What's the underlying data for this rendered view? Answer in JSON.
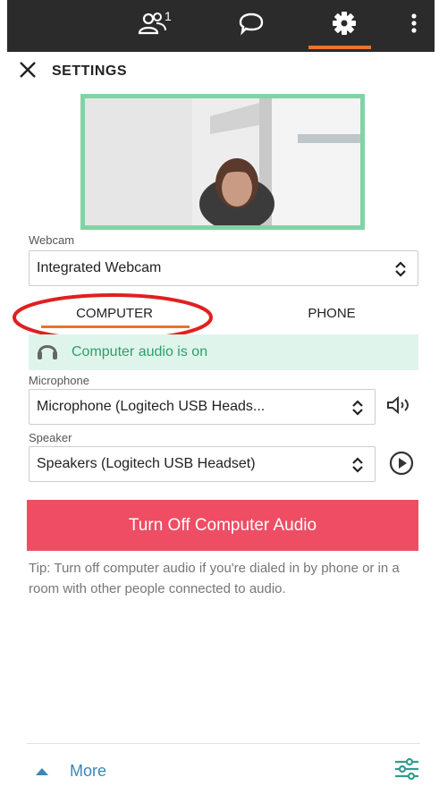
{
  "topbar": {
    "participant_count": "1",
    "icons": [
      "people-icon",
      "chat-icon",
      "gear-icon",
      "more-vertical-icon"
    ],
    "active_tab_color": "#e8742c"
  },
  "header": {
    "title": "SETTINGS"
  },
  "webcam": {
    "label": "Webcam",
    "selected": "Integrated Webcam"
  },
  "audio_tabs": {
    "computer": "COMPUTER",
    "phone": "PHONE",
    "active": "COMPUTER"
  },
  "status": {
    "text": "Computer audio is on",
    "color": "#2e9e69"
  },
  "microphone": {
    "label": "Microphone",
    "selected": "Microphone  (Logitech  USB  Heads..."
  },
  "speaker": {
    "label": "Speaker",
    "selected": "Speakers (Logitech USB Headset)"
  },
  "action": {
    "label": "Turn Off Computer Audio",
    "color": "#ee4d63"
  },
  "tip": {
    "text": "Tip: Turn off computer audio if you're dialed in by phone or in a room with other people connected to audio."
  },
  "footer": {
    "more_label": "More",
    "accent": "#3a86b5"
  }
}
